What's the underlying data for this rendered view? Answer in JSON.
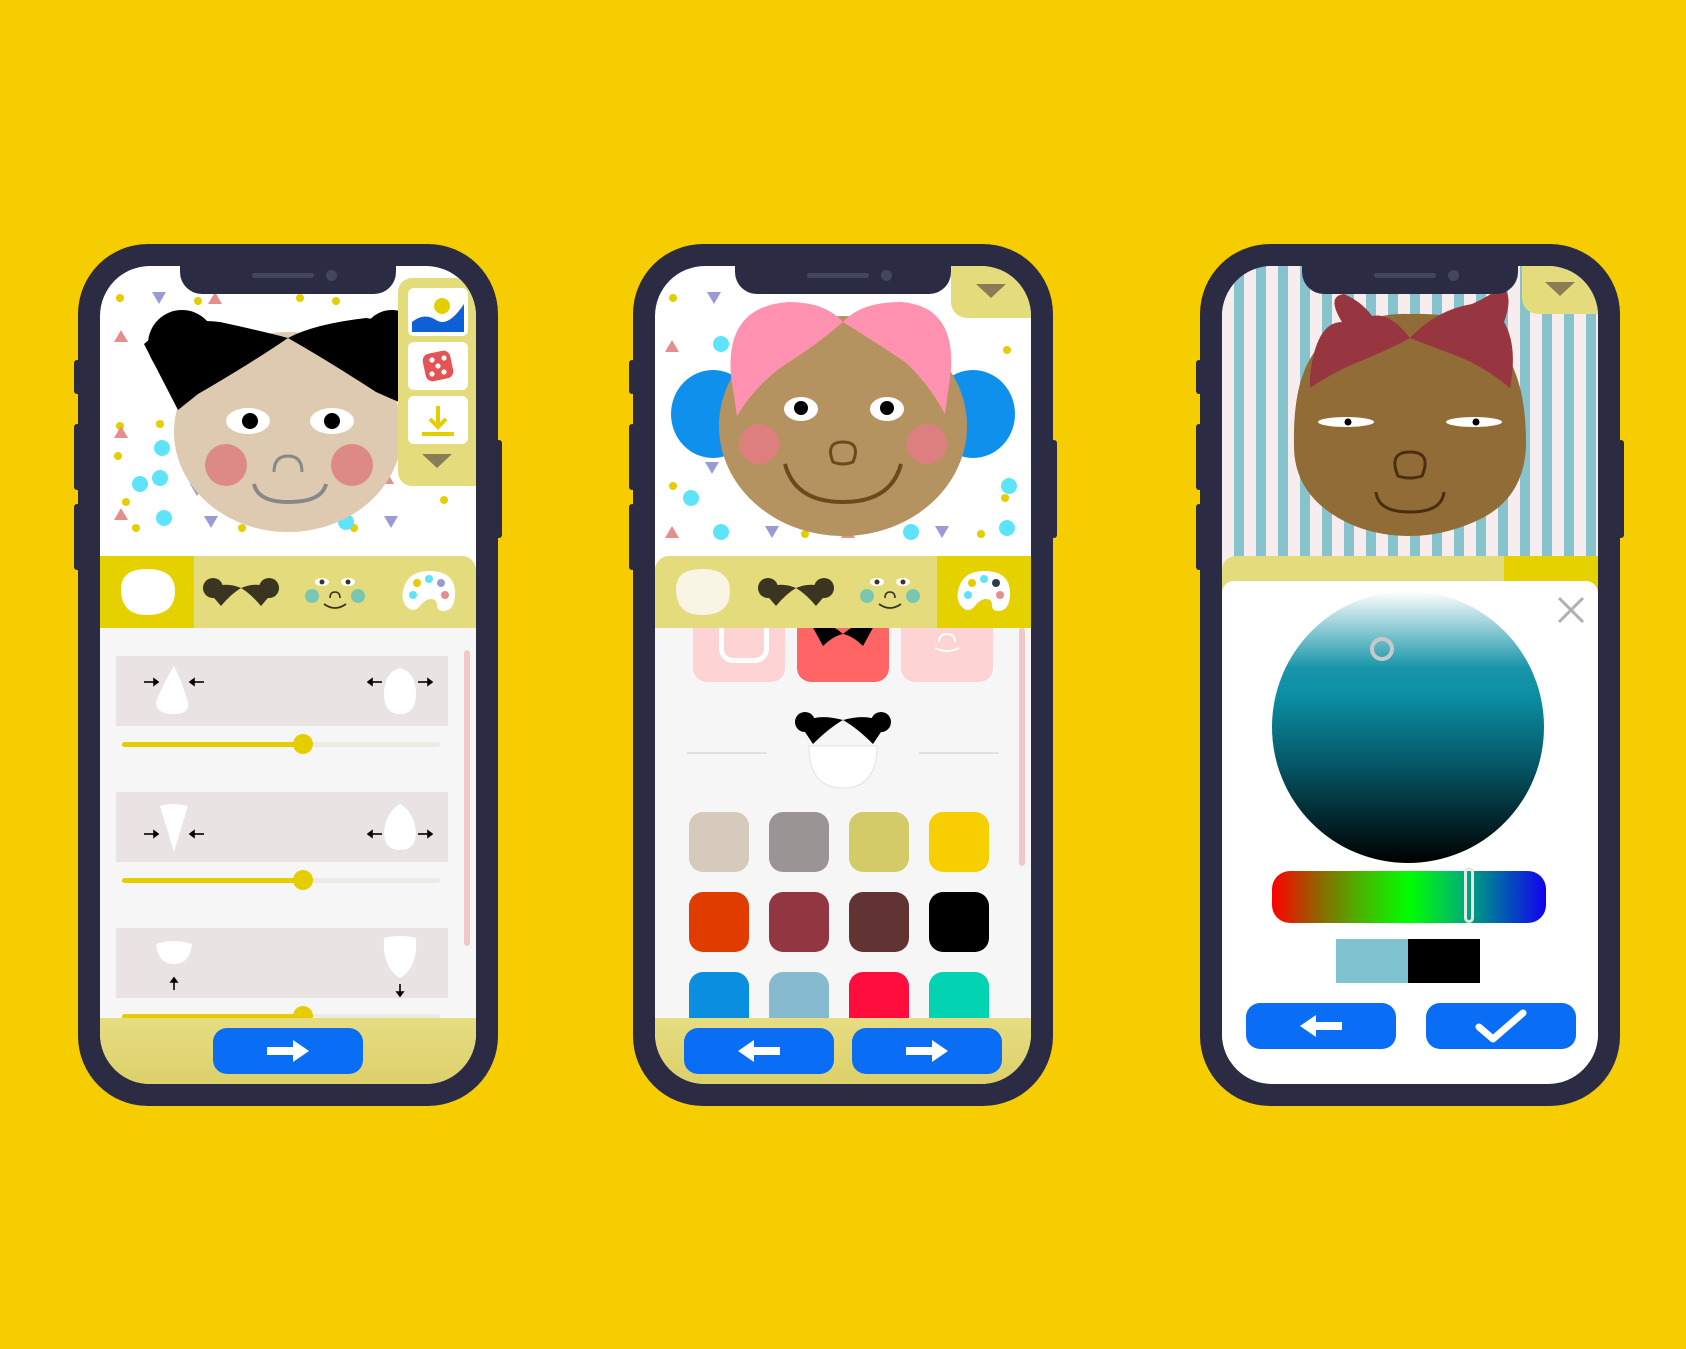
{
  "background_color": "#F6CD00",
  "screens": [
    {
      "id": "shape-editor",
      "tabs": [
        "face-shape-icon",
        "hair-icon",
        "face-features-icon",
        "palette-icon"
      ],
      "active_tab": 0,
      "tools": [
        "background-icon",
        "random-dice-icon",
        "download-icon",
        "chevron-down-icon"
      ],
      "sliders": [
        {
          "value": 0.57
        },
        {
          "value": 0.57
        },
        {
          "value": 0.57
        }
      ],
      "nav": [
        "next-arrow-icon"
      ]
    },
    {
      "id": "color-editor",
      "tabs": [
        "face-shape-icon",
        "hair-icon",
        "face-features-icon",
        "palette-icon"
      ],
      "active_tab": 3,
      "swatches": [
        "#D5CABB",
        "#9A9495",
        "#D3CA68",
        "#F7CE00",
        "#E03C00",
        "#923641",
        "#613333",
        "#000000",
        "#0A8EE0",
        "#86BBCF",
        "#FF0E3D",
        "#00D2B2"
      ],
      "nav": [
        "back-arrow-icon",
        "next-arrow-icon"
      ]
    },
    {
      "id": "color-picker",
      "current_color": "#7FC3D0",
      "previous_color": "#000000",
      "hue_value": 0.72,
      "nav": [
        "back-arrow-icon",
        "confirm-check-icon"
      ]
    }
  ]
}
